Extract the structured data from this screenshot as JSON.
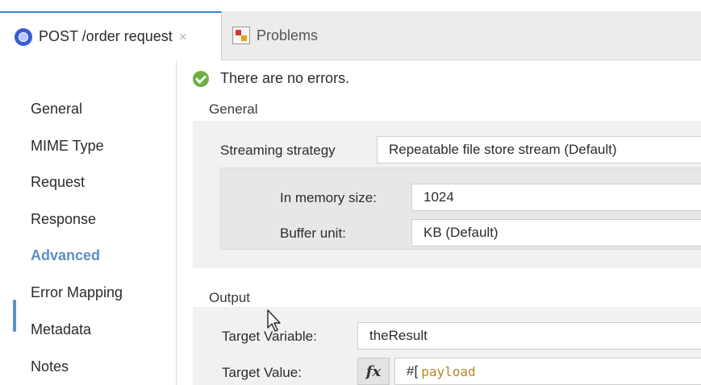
{
  "tabs": {
    "active": {
      "label": "POST /order request",
      "close": "×"
    },
    "problems": {
      "label": "Problems"
    }
  },
  "status": {
    "message": "There are no errors."
  },
  "sidebar": {
    "items": [
      {
        "label": "General"
      },
      {
        "label": "MIME Type"
      },
      {
        "label": "Request"
      },
      {
        "label": "Response"
      },
      {
        "label": "Advanced",
        "active": true
      },
      {
        "label": "Error Mapping"
      },
      {
        "label": "Metadata"
      },
      {
        "label": "Notes"
      }
    ]
  },
  "general": {
    "title": "General",
    "streaming_label": "Streaming strategy",
    "streaming_value": "Repeatable file store stream (Default)",
    "memory_label": "In memory size:",
    "memory_value": "1024",
    "buffer_label": "Buffer unit:",
    "buffer_value": "KB (Default)"
  },
  "output": {
    "title": "Output",
    "target_variable_label": "Target Variable:",
    "target_variable_value": "theResult",
    "target_value_label": "Target Value:",
    "fx": "fx",
    "expr_prefix": "#[",
    "expr_body": "payload"
  },
  "colors": {
    "accent": "#5b8fc7",
    "success": "#6cb043",
    "expression": "#b8872a"
  }
}
